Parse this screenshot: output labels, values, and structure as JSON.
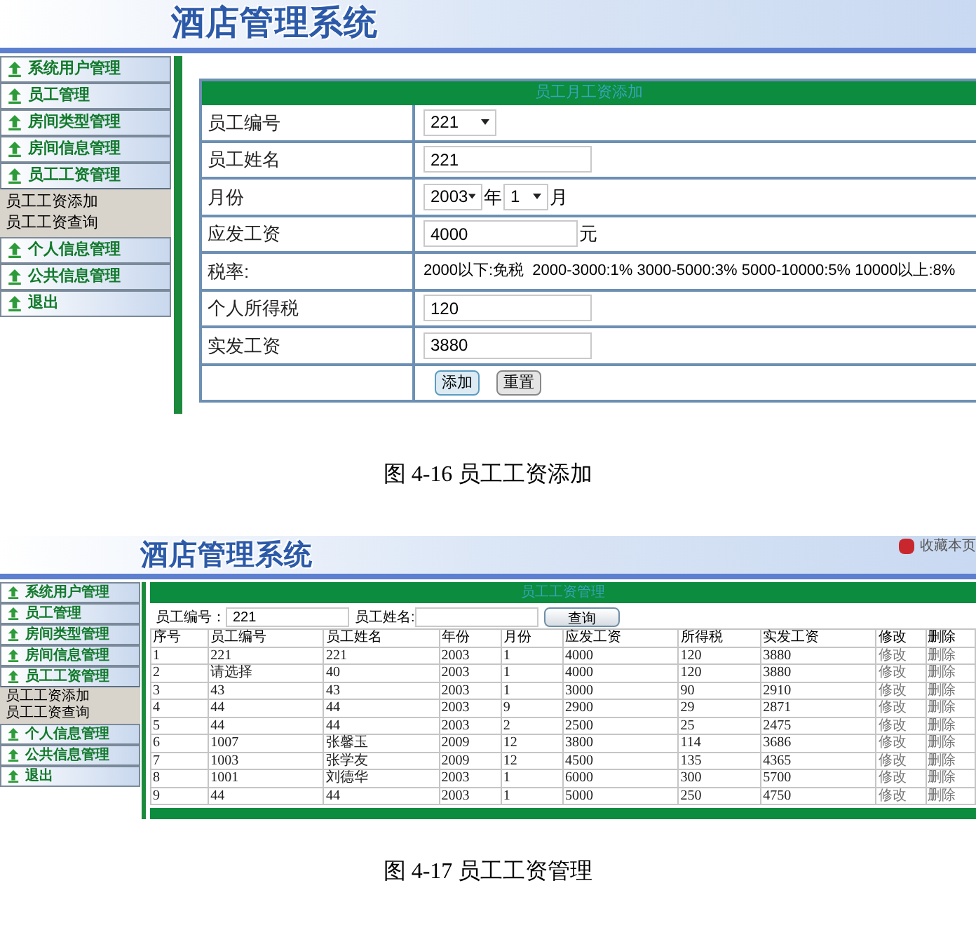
{
  "figures": [
    {
      "kind": "add_form",
      "header_title": "酒店管理系统",
      "sidebar": [
        {
          "label": "系统用户管理",
          "expanded": false
        },
        {
          "label": "员工管理",
          "expanded": false
        },
        {
          "label": "房间类型管理",
          "expanded": false
        },
        {
          "label": "房间信息管理",
          "expanded": false
        },
        {
          "label": "员工工资管理",
          "expanded": true,
          "children": [
            "员工工资添加",
            "员工工资查询"
          ]
        },
        {
          "label": "个人信息管理",
          "expanded": false
        },
        {
          "label": "公共信息管理",
          "expanded": false
        },
        {
          "label": "退出",
          "expanded": false
        }
      ],
      "form": {
        "title": "员工月工资添加",
        "rows": [
          {
            "kind": "select",
            "label": "员工编号",
            "value": "221"
          },
          {
            "kind": "input",
            "label": "员工姓名",
            "value": "221"
          },
          {
            "kind": "date",
            "label": "月份",
            "year": "2003",
            "year_unit": "年",
            "month": "1",
            "month_unit": "月"
          },
          {
            "kind": "input",
            "label": "应发工资",
            "value": "4000",
            "unit": "元"
          },
          {
            "kind": "text",
            "label": "税率:",
            "value": "2000以下:免税  2000-3000:1% 3000-5000:3% 5000-10000:5% 10000以上:8%"
          },
          {
            "kind": "input",
            "label": "个人所得税",
            "value": "120"
          },
          {
            "kind": "input",
            "label": "实发工资",
            "value": "3880"
          },
          {
            "kind": "buttons",
            "buttons": [
              "添加",
              "重置"
            ]
          }
        ]
      },
      "caption": "图 4-16 员工工资添加"
    },
    {
      "kind": "list",
      "header_title": "酒店管理系统",
      "corner_link": "收藏本页",
      "sidebar": [
        {
          "label": "系统用户管理",
          "expanded": false
        },
        {
          "label": "员工管理",
          "expanded": false
        },
        {
          "label": "房间类型管理",
          "expanded": false
        },
        {
          "label": "房间信息管理",
          "expanded": false
        },
        {
          "label": "员工工资管理",
          "expanded": true,
          "children": [
            "员工工资添加",
            "员工工资查询"
          ]
        },
        {
          "label": "个人信息管理",
          "expanded": false
        },
        {
          "label": "公共信息管理",
          "expanded": false
        },
        {
          "label": "退出",
          "expanded": false
        }
      ],
      "list": {
        "title": "员工工资管理",
        "search": [
          {
            "label": "员工编号：",
            "value": "221"
          },
          {
            "label": "员工姓名:"
          }
        ],
        "search_button": "查询",
        "columns": [
          "序号",
          "员工编号",
          "员工姓名",
          "年份",
          "月份",
          "应发工资",
          "所得税",
          "实发工资",
          "修改",
          "删除"
        ],
        "rows": [
          [
            "1",
            "221",
            "221",
            "2003",
            "1",
            "4000",
            "120",
            "3880",
            "修改",
            "删除"
          ],
          [
            "2",
            "请选择",
            "40",
            "2003",
            "1",
            "4000",
            "120",
            "3880",
            "修改",
            "删除"
          ],
          [
            "3",
            "43",
            "43",
            "2003",
            "1",
            "3000",
            "90",
            "2910",
            "修改",
            "删除"
          ],
          [
            "4",
            "44",
            "44",
            "2003",
            "9",
            "2900",
            "29",
            "2871",
            "修改",
            "删除"
          ],
          [
            "5",
            "44",
            "44",
            "2003",
            "2",
            "2500",
            "25",
            "2475",
            "修改",
            "删除"
          ],
          [
            "6",
            "1007",
            "张馨玉",
            "2009",
            "12",
            "3800",
            "114",
            "3686",
            "修改",
            "删除"
          ],
          [
            "7",
            "1003",
            "张学友",
            "2009",
            "12",
            "4500",
            "135",
            "4365",
            "修改",
            "删除"
          ],
          [
            "8",
            "1001",
            "刘德华",
            "2003",
            "1",
            "6000",
            "300",
            "5700",
            "修改",
            "删除"
          ],
          [
            "9",
            "44",
            "44",
            "2003",
            "1",
            "5000",
            "250",
            "4750",
            "修改",
            "删除"
          ]
        ]
      },
      "caption": "图 4-17 员工工资管理"
    }
  ]
}
